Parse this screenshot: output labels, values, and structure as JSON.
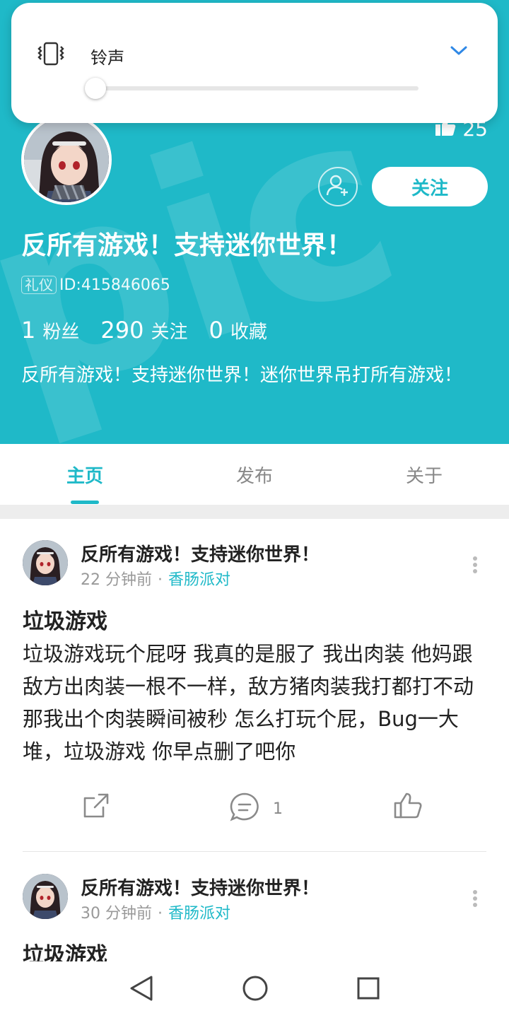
{
  "volume_panel": {
    "label": "铃声",
    "level": 0.0
  },
  "profile": {
    "likes_count": "25",
    "follow_label": "关注",
    "nickname": "反所有游戏！支持迷你世界！",
    "badge": "礼仪",
    "id_text": "ID:415846065",
    "stats": [
      {
        "value": "1",
        "label": "粉丝"
      },
      {
        "value": "290",
        "label": "关注"
      },
      {
        "value": "0",
        "label": "收藏"
      }
    ],
    "bio": "反所有游戏！支持迷你世界！迷你世界吊打所有游戏！"
  },
  "tabs": [
    {
      "label": "主页",
      "active": true
    },
    {
      "label": "发布",
      "active": false
    },
    {
      "label": "关于",
      "active": false
    }
  ],
  "posts": [
    {
      "author": "反所有游戏！支持迷你世界！",
      "time": "22 分钟前",
      "category": "香肠派对",
      "title": "垃圾游戏",
      "body": "垃圾游戏玩个屁呀 我真的是服了 我出肉装 他妈跟敌方出肉装一根不一样，敌方猪肉装我打都打不动 那我出个肉装瞬间被秒 怎么打玩个屁，Bug一大堆，垃圾游戏 你早点删了吧你",
      "comments": "1"
    },
    {
      "author": "反所有游戏！支持迷你世界！",
      "time": "30 分钟前",
      "category": "香肠派对",
      "title": "垃圾游戏"
    }
  ],
  "colors": {
    "accent": "#1fb9c8",
    "header_bg": "#1fb9c8",
    "meta_gray": "#999999"
  },
  "icons": {
    "vibrate": "vibrate-icon",
    "chevron": "chevron-down-icon",
    "thumbs_up": "thumbs-up-icon",
    "add_friend": "add-friend-icon",
    "share": "share-icon",
    "comment": "comment-icon",
    "more": "more-vertical-icon",
    "nav_back": "back-triangle-icon",
    "nav_home": "home-circle-icon",
    "nav_recents": "recents-square-icon"
  }
}
